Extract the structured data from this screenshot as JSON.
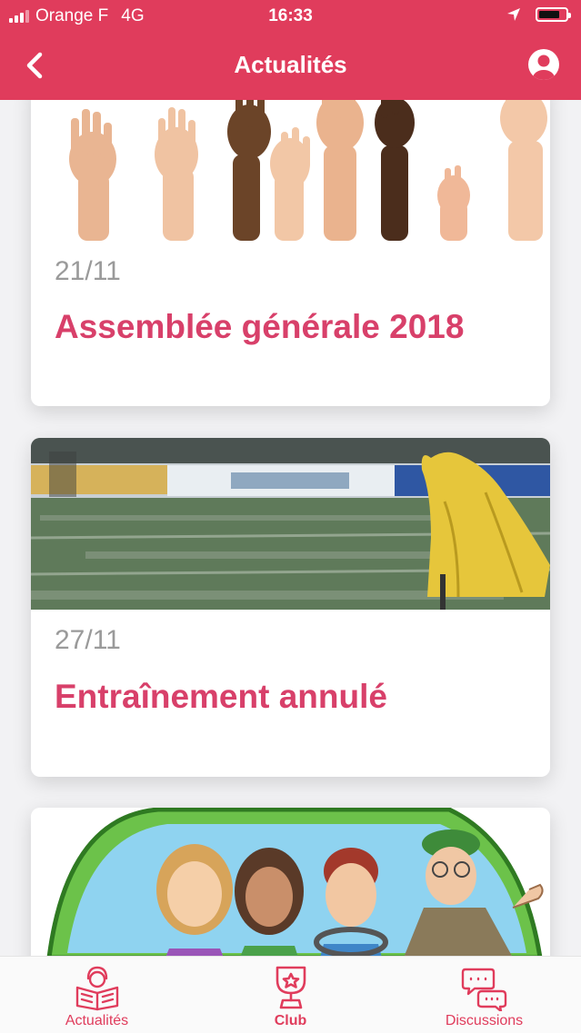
{
  "status_bar": {
    "carrier": "Orange F",
    "network": "4G",
    "time": "16:33",
    "battery_level": 0.8
  },
  "nav": {
    "title": "Actualités",
    "back_icon": "chevron-left-icon",
    "profile_icon": "account-circle-icon"
  },
  "feed": {
    "items": [
      {
        "date": "21/11",
        "title": "Assemblée générale 2018",
        "image": "raised-hands-photo"
      },
      {
        "date": "27/11",
        "title": "Entraînement annulé",
        "image": "rainy-pitch-photo"
      },
      {
        "date": "",
        "title": "",
        "image": "carpool-cartoon"
      }
    ]
  },
  "tabbar": {
    "items": [
      {
        "label": "Actualités",
        "icon": "reader-news-icon"
      },
      {
        "label": "Club",
        "icon": "trophy-star-icon"
      },
      {
        "label": "Discussions",
        "icon": "chat-bubbles-icon"
      }
    ]
  },
  "colors": {
    "brand": "#e03c5c",
    "title": "#d8406a",
    "date": "#9a9a9a"
  }
}
